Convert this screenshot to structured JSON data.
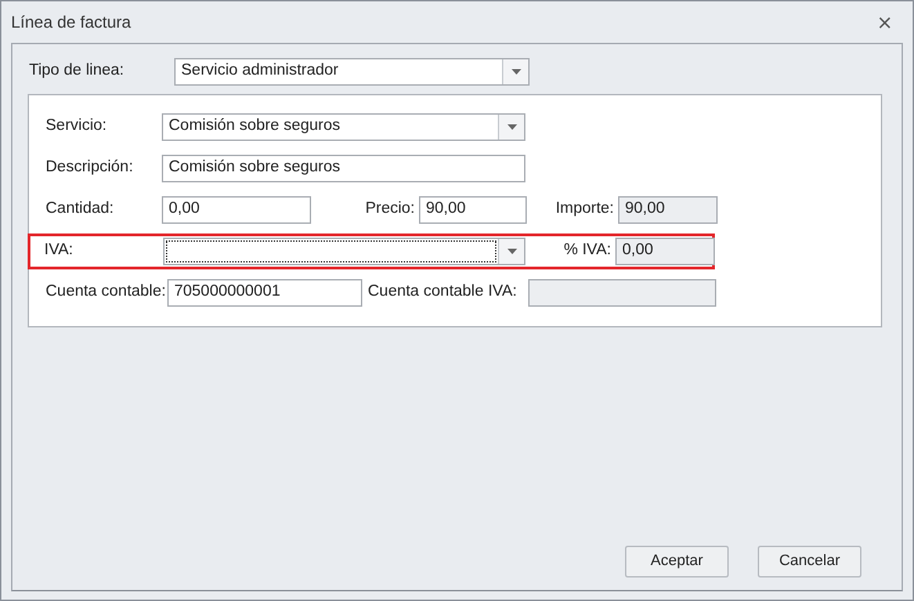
{
  "window": {
    "title": "Línea de factura",
    "close": "⨯"
  },
  "line_type": {
    "label": "Tipo de linea:",
    "value": "Servicio administrador"
  },
  "rows": [
    {
      "highlighted": false,
      "items": [
        {
          "kind": "label",
          "text": "Servicio:"
        },
        {
          "kind": "combo",
          "value": "Comisión sobre seguros",
          "focused": false
        }
      ]
    },
    {
      "highlighted": false,
      "items": [
        {
          "kind": "label",
          "text": "Descripción:"
        },
        {
          "kind": "input",
          "value": "Comisión sobre seguros",
          "readonly": false
        }
      ]
    },
    {
      "highlighted": false,
      "items": [
        {
          "kind": "label",
          "text": "Cantidad:"
        },
        {
          "kind": "input",
          "value": "0,00",
          "readonly": false
        },
        {
          "kind": "label",
          "text": "Precio:"
        },
        {
          "kind": "input",
          "value": "90,00",
          "readonly": false
        },
        {
          "kind": "label",
          "text": "Importe:"
        },
        {
          "kind": "input",
          "value": "90,00",
          "readonly": true
        }
      ]
    },
    {
      "highlighted": true,
      "items": [
        {
          "kind": "label",
          "text": "IVA:"
        },
        {
          "kind": "combo",
          "value": "",
          "focused": true
        },
        {
          "kind": "label",
          "text": "% IVA:"
        },
        {
          "kind": "input",
          "value": "0,00",
          "readonly": true
        }
      ]
    },
    {
      "highlighted": false,
      "items": [
        {
          "kind": "label",
          "text": "Cuenta contable:"
        },
        {
          "kind": "input",
          "value": "705000000001",
          "readonly": false
        },
        {
          "kind": "label",
          "text": "Cuenta contable IVA:"
        },
        {
          "kind": "input",
          "value": "",
          "readonly": true
        }
      ]
    }
  ],
  "buttons": [
    "Aceptar",
    "Cancelar"
  ]
}
